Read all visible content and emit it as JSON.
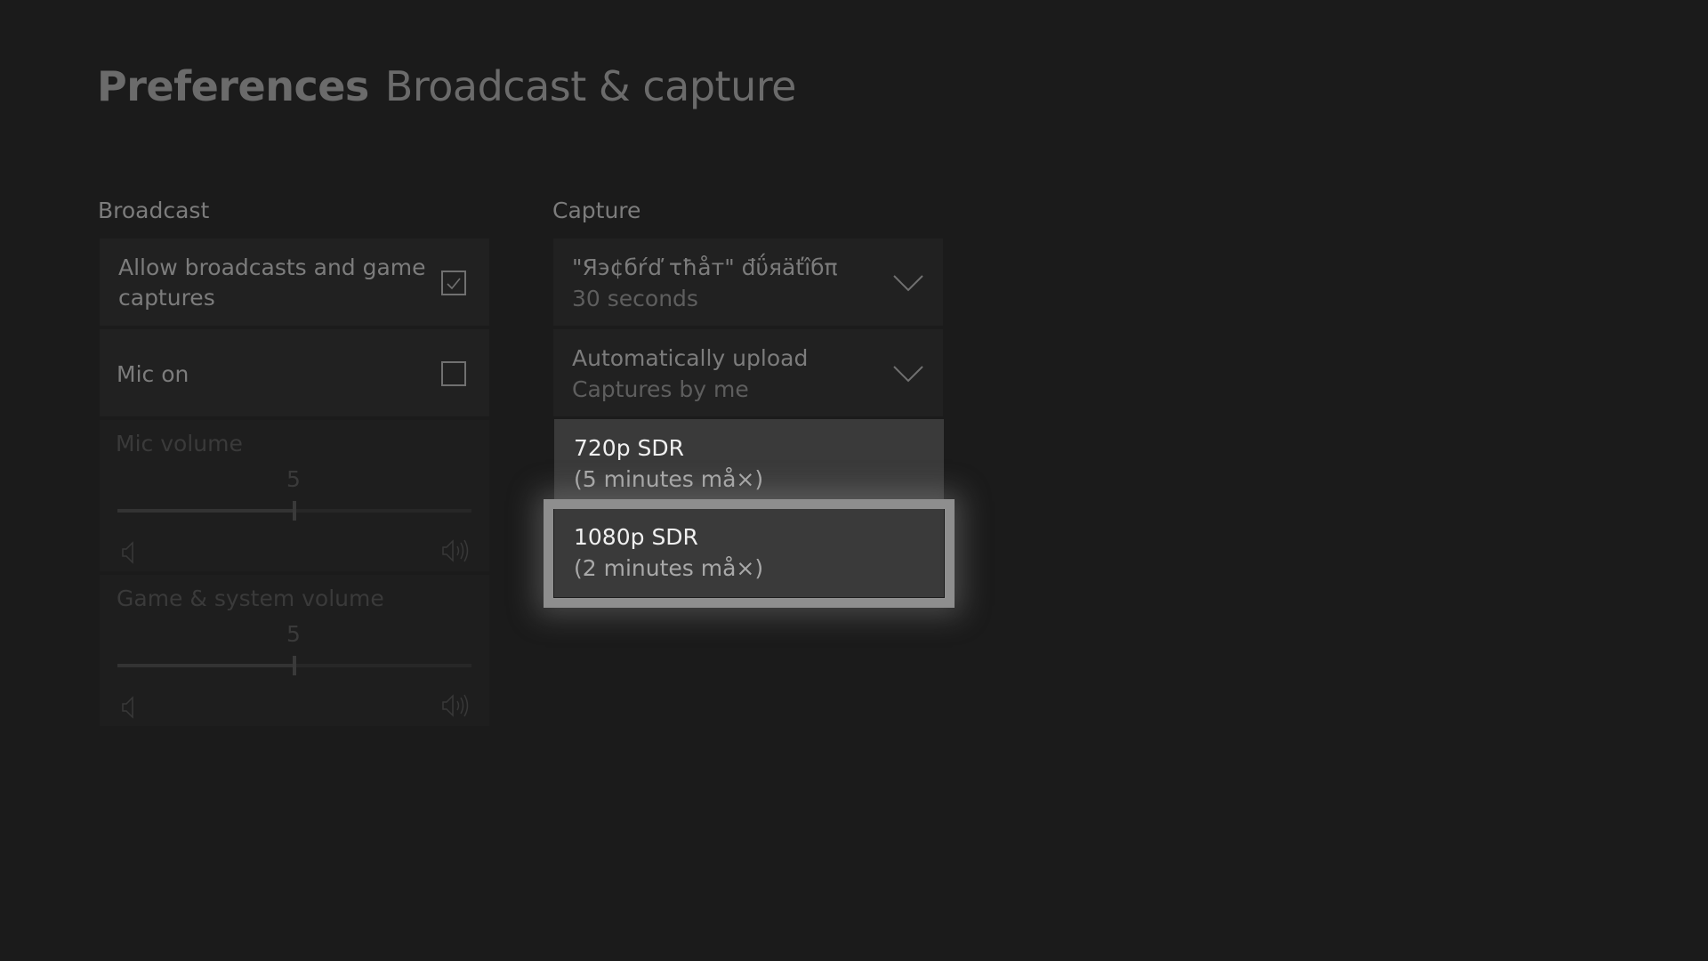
{
  "header": {
    "title": "Preferences",
    "subtitle": "Broadcast & capture"
  },
  "broadcast": {
    "label": "Broadcast",
    "allow_broadcasts": {
      "label_line1": "Allow broadcasts and game",
      "label_line2": "captures",
      "checked": true
    },
    "mic_on": {
      "label": "Mic on",
      "checked": false
    },
    "mic_volume": {
      "label": "Mic volume",
      "value": "5",
      "min": 0,
      "max": 10
    },
    "game_volume": {
      "label": "Game & system volume",
      "value": "5",
      "min": 0,
      "max": 10
    }
  },
  "capture": {
    "label": "Capture",
    "record_duration": {
      "label": "\"Яэ¢бŕď τħåт\" đΰяäťîбπ",
      "value": "30 seconds"
    },
    "auto_upload": {
      "label": "Automatically upload",
      "value": "Captures by me"
    },
    "resolution_options": [
      {
        "title": "720p SDR",
        "subtitle": "(5 minutes må×)"
      },
      {
        "title": "1080p SDR",
        "subtitle": "(2 minutes må×)",
        "focused": true
      }
    ]
  }
}
